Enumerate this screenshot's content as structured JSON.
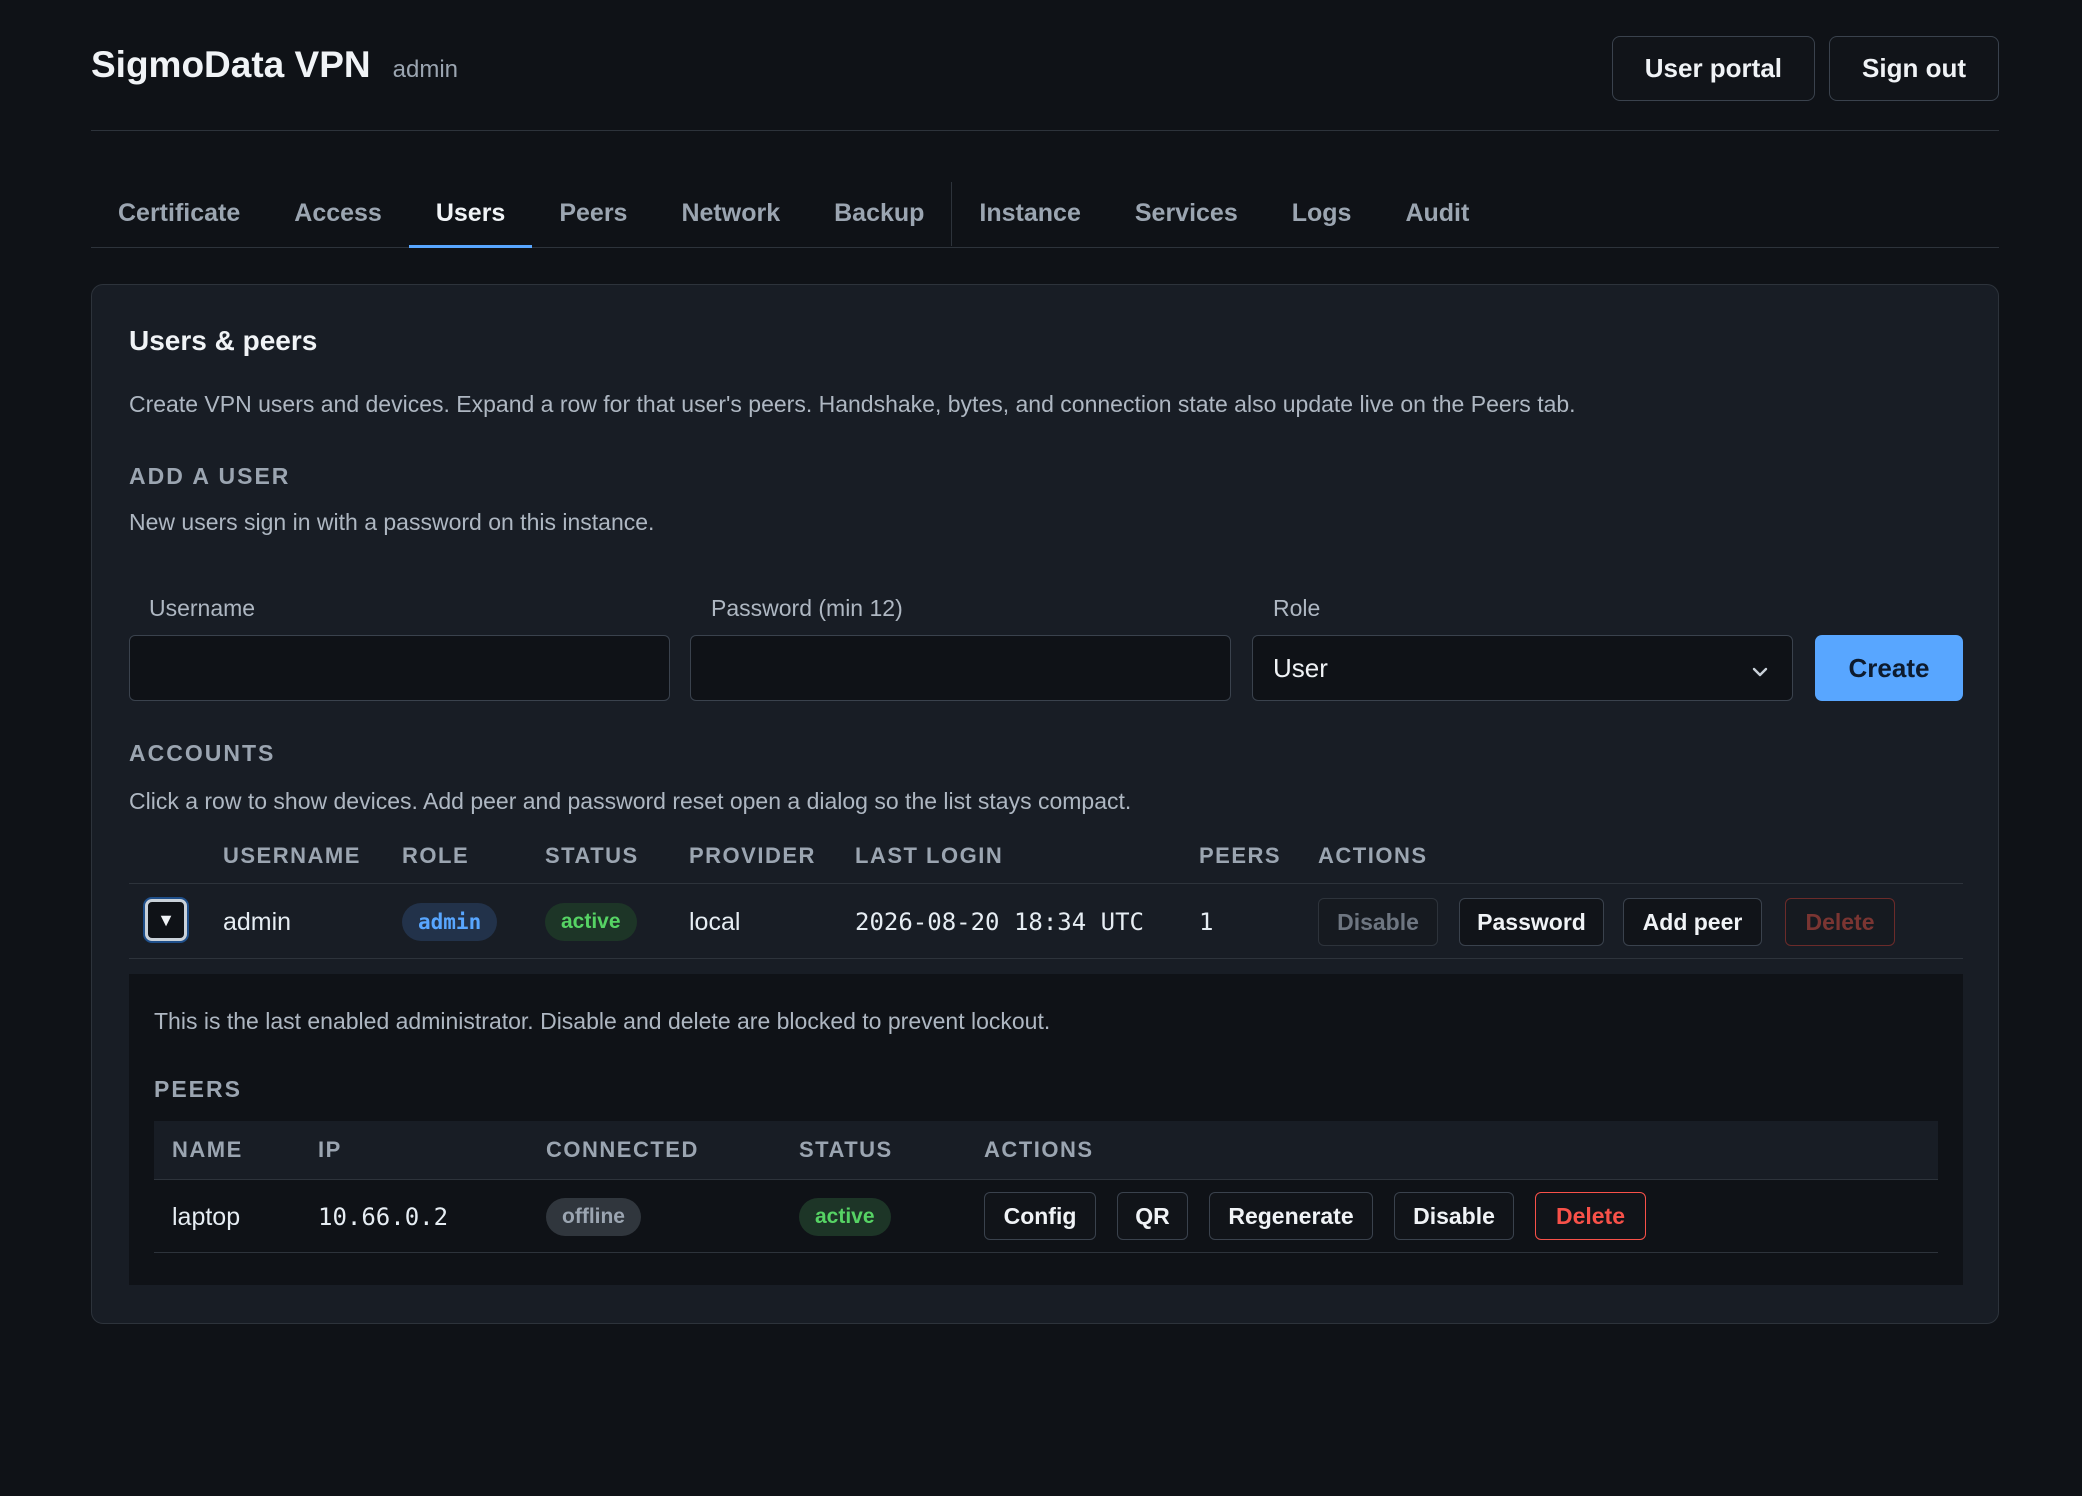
{
  "app": {
    "title": "SigmoData VPN",
    "role": "admin"
  },
  "header": {
    "user_portal": "User portal",
    "sign_out": "Sign out"
  },
  "tabs": [
    "Certificate",
    "Access",
    "Users",
    "Peers",
    "Network",
    "Backup",
    "Instance",
    "Services",
    "Logs",
    "Audit"
  ],
  "active_tab": "Users",
  "card": {
    "title": "Users & peers",
    "description": "Create VPN users and devices. Expand a row for that user's peers. Handshake, bytes, and connection state also update live on the Peers tab."
  },
  "add_user": {
    "heading": "ADD A USER",
    "description": "New users sign in with a password on this instance.",
    "username_label": "Username",
    "username_value": "",
    "password_label": "Password (min 12)",
    "password_value": "",
    "role_label": "Role",
    "role_value": "User",
    "create_button": "Create"
  },
  "accounts": {
    "heading": "ACCOUNTS",
    "description": "Click a row to show devices. Add peer and password reset open a dialog so the list stays compact.",
    "columns": [
      "USERNAME",
      "ROLE",
      "STATUS",
      "PROVIDER",
      "LAST LOGIN",
      "PEERS",
      "ACTIONS"
    ],
    "rows": [
      {
        "toggle": "▼",
        "username": "admin",
        "role": "admin",
        "status": "active",
        "provider": "local",
        "last_login": "2026-08-20 18:34 UTC",
        "peers": "1",
        "actions": {
          "disable": "Disable",
          "password": "Password",
          "add_peer": "Add peer",
          "delete": "Delete"
        }
      }
    ]
  },
  "expanded": {
    "note": "This is the last enabled administrator. Disable and delete are blocked to prevent lockout.",
    "peers_heading": "PEERS",
    "columns": [
      "NAME",
      "IP",
      "CONNECTED",
      "STATUS",
      "ACTIONS"
    ],
    "rows": [
      {
        "name": "laptop",
        "ip": "10.66.0.2",
        "connected": "offline",
        "status": "active",
        "actions": {
          "config": "Config",
          "qr": "QR",
          "regenerate": "Regenerate",
          "disable": "Disable",
          "delete": "Delete"
        }
      }
    ]
  },
  "colors": {
    "accent": "#58a6ff",
    "success": "#56d364",
    "danger": "#f85149",
    "background": "#0f1217",
    "card": "#181d25"
  }
}
